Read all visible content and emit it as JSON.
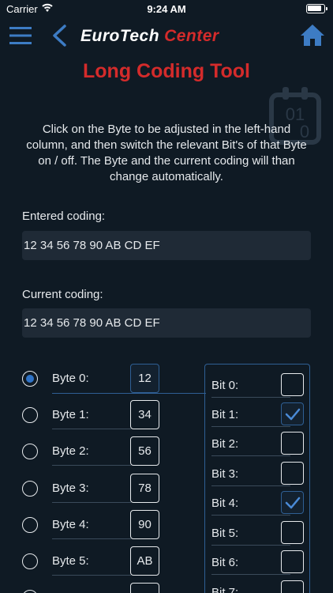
{
  "status_bar": {
    "carrier": "Carrier",
    "time": "9:24 AM"
  },
  "nav": {
    "logo_part1": "EuroTech",
    "logo_part2": "Center"
  },
  "page_title": "Long Coding Tool",
  "instructions": "Click on the Byte to be adjusted in the left-hand column, and then switch the relevant Bit's of that Byte on / off. The Byte and the current coding will than change automatically.",
  "entered_coding": {
    "label": "Entered coding:",
    "value": "12 34 56 78 90 AB CD EF"
  },
  "current_coding": {
    "label": "Current coding:",
    "value": "12 34 56 78 90 AB CD EF"
  },
  "bytes": [
    {
      "label": "Byte 0:",
      "value": "12",
      "selected": true
    },
    {
      "label": "Byte 1:",
      "value": "34",
      "selected": false
    },
    {
      "label": "Byte 2:",
      "value": "56",
      "selected": false
    },
    {
      "label": "Byte 3:",
      "value": "78",
      "selected": false
    },
    {
      "label": "Byte 4:",
      "value": "90",
      "selected": false
    },
    {
      "label": "Byte 5:",
      "value": "AB",
      "selected": false
    },
    {
      "label": "",
      "value": "",
      "selected": false
    }
  ],
  "bits": [
    {
      "label": "Bit 0:",
      "checked": false
    },
    {
      "label": "Bit 1:",
      "checked": true
    },
    {
      "label": "Bit 2:",
      "checked": false
    },
    {
      "label": "Bit 3:",
      "checked": false
    },
    {
      "label": "Bit 4:",
      "checked": true
    },
    {
      "label": "Bit 5:",
      "checked": false
    },
    {
      "label": "Bit 6:",
      "checked": false
    },
    {
      "label": "Bit 7:",
      "checked": false
    }
  ],
  "colors": {
    "accent_red": "#d42b2b",
    "accent_blue": "#2f73c6",
    "background": "#0f1a24"
  },
  "icons": {
    "menu": "hamburger-menu-icon",
    "back": "chevron-left-icon",
    "home": "home-icon",
    "watermark": "binary-calendar-icon",
    "checkmark": "checkmark-icon"
  }
}
